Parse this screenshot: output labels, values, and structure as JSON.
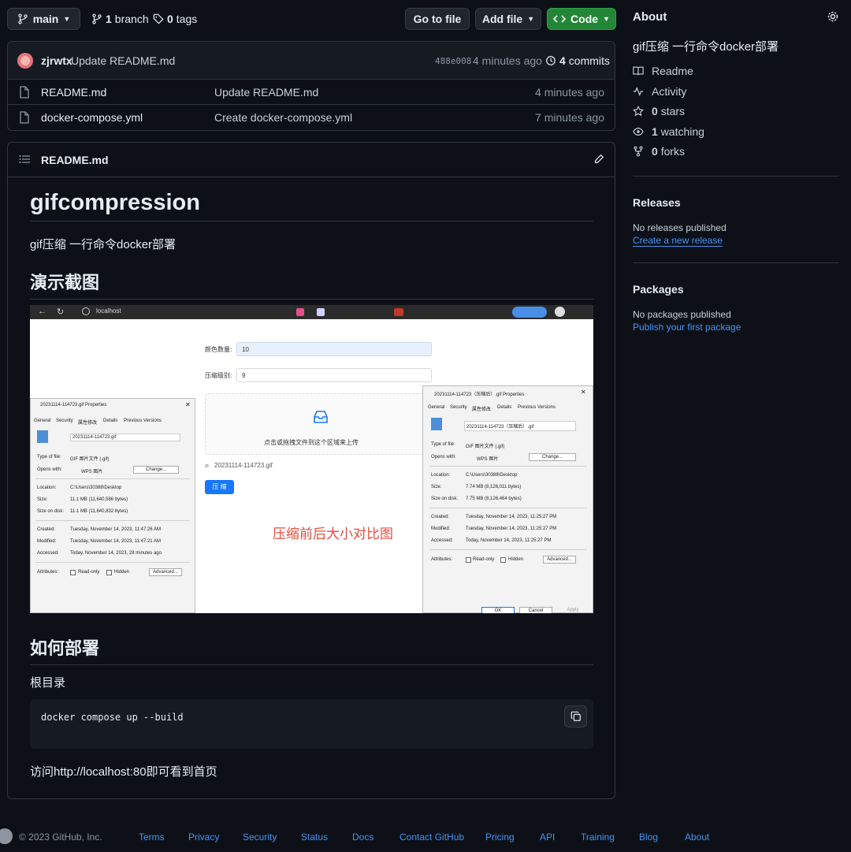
{
  "toolbar": {
    "branch_button": "main",
    "branches_count": "1",
    "branches_label": "branch",
    "tags_count": "0",
    "tags_label": "tags",
    "go_to_file": "Go to file",
    "add_file": "Add file",
    "code": "Code"
  },
  "commit": {
    "author": "zjrwtx",
    "message": "Update README.md",
    "sha": "488e008",
    "time": "4 minutes ago",
    "commits_count": "4",
    "commits_label": "commits"
  },
  "files": [
    {
      "name": "README.md",
      "message": "Update README.md",
      "time": "4 minutes ago"
    },
    {
      "name": "docker-compose.yml",
      "message": "Create docker-compose.yml",
      "time": "7 minutes ago"
    }
  ],
  "readme": {
    "filename": "README.md",
    "title": "gifcompression",
    "intro": "gif压缩 一行命令docker部署",
    "h2_demo": "演示截图",
    "h2_deploy": "如何部署",
    "root_label": "根目录",
    "code": "docker compose up --build",
    "visit": "访问http://localhost:80即可看到首页"
  },
  "screenshot": {
    "url": "localhost",
    "colors_label": "颜色数量:",
    "colors_value": "10",
    "level_label": "压缩级别:",
    "level_value": "9",
    "upload_text": "点击或拖拽文件到这个区域来上传",
    "uploaded_file": "20231114-114723.gif",
    "compress_button": "压 缩",
    "overlay_caption": "压缩前后大小对比图",
    "left_dialog": {
      "title": "20231114-114723.gif Properties",
      "tabs": [
        "General",
        "Security",
        "属性修改",
        "Details",
        "Previous Versions"
      ],
      "filename": "20231114-114723.gif",
      "type_label": "Type of file:",
      "type_value": "GIF 图片文件 (.gif)",
      "opens_label": "Opens with:",
      "opens_value": "WPS 图片",
      "change": "Change...",
      "location_label": "Location:",
      "location_value": "C:\\Users\\30388\\Desktop",
      "size_label": "Size:",
      "size_value": "11.1 MB (11,640,586 bytes)",
      "disk_label": "Size on disk:",
      "disk_value": "11.1 MB (11,640,832 bytes)",
      "created_label": "Created:",
      "created_value": "Tuesday, November 14, 2023, 11:47:26 AM",
      "modified_label": "Modified:",
      "modified_value": "Tuesday, November 14, 2023, 11:47:21 AM",
      "accessed_label": "Accessed:",
      "accessed_value": "Today, November 14, 2023, 28 minutes ago",
      "attr_label": "Attributes:",
      "readonly": "Read-only",
      "hidden": "Hidden",
      "advanced": "Advanced..."
    },
    "right_dialog": {
      "title": "20231114-114723（压缩后）.gif Properties",
      "tabs": [
        "General",
        "Security",
        "属性修改",
        "Details",
        "Previous Versions"
      ],
      "filename": "20231114-114723（压缩后）.gif",
      "type_label": "Type of file:",
      "type_value": "GIF 图片文件 (.gif)",
      "opens_label": "Opens with:",
      "opens_value": "WPS 图片",
      "change": "Change...",
      "location_label": "Location:",
      "location_value": "C:\\Users\\30388\\Desktop",
      "size_label": "Size:",
      "size_value": "7.74 MB (8,126,011 bytes)",
      "disk_label": "Size on disk:",
      "disk_value": "7.75 MB (8,126,464 bytes)",
      "created_label": "Created:",
      "created_value": "Tuesday, November 14, 2023, 11:25:27 PM",
      "modified_label": "Modified:",
      "modified_value": "Tuesday, November 14, 2023, 11:25:27 PM",
      "accessed_label": "Accessed:",
      "accessed_value": "Today, November 14, 2023, 11:25:27 PM",
      "attr_label": "Attributes:",
      "readonly": "Read-only",
      "hidden": "Hidden",
      "advanced": "Advanced...",
      "ok": "OK",
      "cancel": "Cancel",
      "apply": "Apply"
    }
  },
  "about": {
    "heading": "About",
    "description": "gif压缩 一行命令docker部署",
    "readme": "Readme",
    "activity": "Activity",
    "stars_count": "0",
    "stars_label": "stars",
    "watching_count": "1",
    "watching_label": "watching",
    "forks_count": "0",
    "forks_label": "forks"
  },
  "releases": {
    "heading": "Releases",
    "none": "No releases published",
    "create": "Create a new release"
  },
  "packages": {
    "heading": "Packages",
    "none": "No packages published",
    "publish": "Publish your first package"
  },
  "footer": {
    "copyright": "© 2023 GitHub, Inc.",
    "links": [
      "Terms",
      "Privacy",
      "Security",
      "Status",
      "Docs",
      "Contact GitHub",
      "Pricing",
      "API",
      "Training",
      "Blog",
      "About"
    ]
  },
  "colors": {
    "background": "#0d1117",
    "code_button": "#238636",
    "link": "#4493f8",
    "border": "#30363d"
  }
}
